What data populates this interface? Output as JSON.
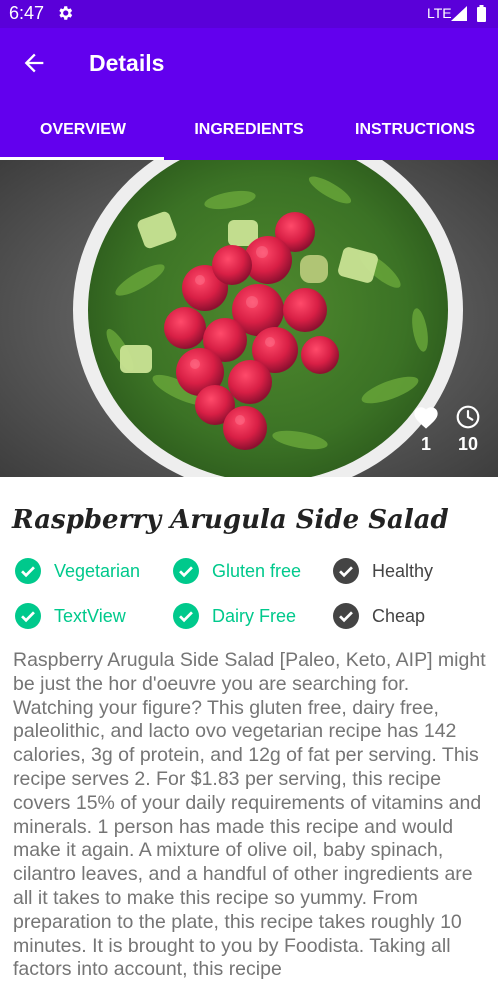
{
  "status_bar": {
    "time": "6:47",
    "network": "LTE",
    "icons": [
      "gear-icon",
      "signal-icon",
      "battery-icon"
    ]
  },
  "app_bar": {
    "title": "Details",
    "back_icon": "arrow-left-icon"
  },
  "tabs": [
    {
      "label": "OVERVIEW",
      "selected": true
    },
    {
      "label": "INGREDIENTS",
      "selected": false
    },
    {
      "label": "INSTRUCTIONS",
      "selected": false
    }
  ],
  "hero": {
    "likes": "1",
    "minutes": "10",
    "icons": [
      "heart-icon",
      "clock-icon"
    ]
  },
  "recipe": {
    "title": "Raspberry Arugula Side Salad",
    "tags": [
      {
        "label": "Vegetarian",
        "active": true
      },
      {
        "label": "Gluten free",
        "active": true
      },
      {
        "label": "Healthy",
        "active": false
      },
      {
        "label": "TextView",
        "active": true
      },
      {
        "label": "Dairy Free",
        "active": true
      },
      {
        "label": "Cheap",
        "active": false
      }
    ],
    "description": "Raspberry Arugula Side Salad [Paleo, Keto, AIP] might be just the hor d'oeuvre you are searching for. Watching your figure? This gluten free, dairy free, paleolithic, and lacto ovo vegetarian recipe has 142 calories, 3g of protein, and 12g of fat per serving. This recipe serves 2. For $1.83 per serving, this recipe covers 15% of your daily requirements of vitamins and minerals. 1 person has made this recipe and would make it again. A mixture of olive oil, baby spinach, cilantro leaves, and a handful of other ingredients are all it takes to make this recipe so yummy. From preparation to the plate, this recipe takes roughly 10 minutes. It is brought to you by Foodista. Taking all factors into account, this recipe"
  },
  "colors": {
    "status_bar": "#5a00d9",
    "app_bar": "#6200ee",
    "tag_active": "#00c98c",
    "tag_inactive": "#444444",
    "description_text": "#757575"
  }
}
